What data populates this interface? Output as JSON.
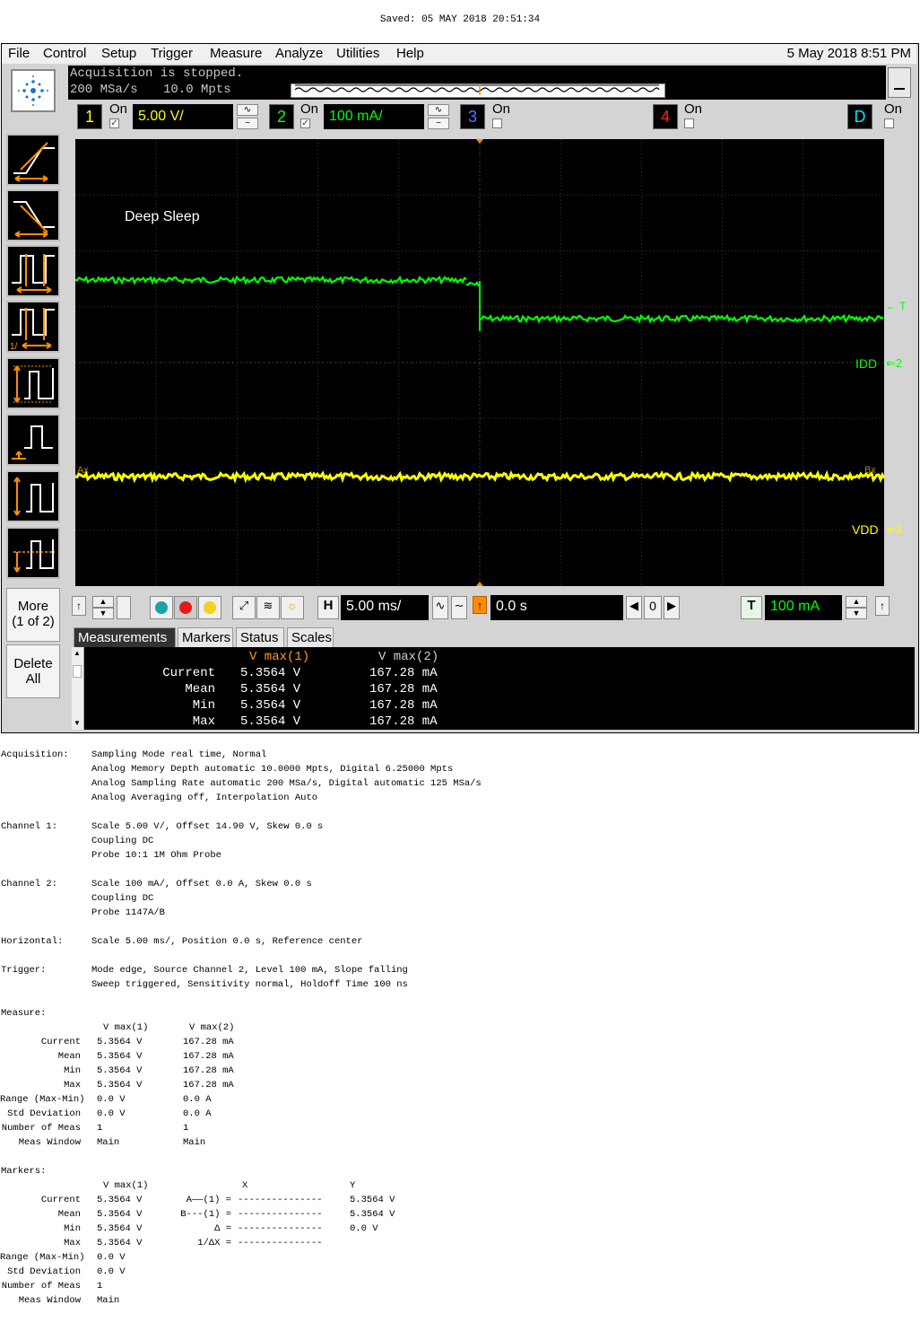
{
  "saved_text": "Saved: 05 MAY 2018  20:51:34",
  "menu": {
    "items": [
      "File",
      "Control",
      "Setup",
      "Trigger",
      "Measure",
      "Analyze",
      "Utilities",
      "Help"
    ],
    "datetime": "5 May 2018  8:51 PM"
  },
  "acquisition": {
    "status": "Acquisition is stopped.",
    "rate": "200 MSa/s",
    "points": "10.0 Mpts"
  },
  "channels": [
    {
      "num": "1",
      "on_label": "On",
      "checked": true,
      "scale": "5.00 V/",
      "color": "#ffff00"
    },
    {
      "num": "2",
      "on_label": "On",
      "checked": true,
      "scale": "100 mA/",
      "color": "#00ff00"
    },
    {
      "num": "3",
      "on_label": "On",
      "checked": false,
      "color": "#4a7dff"
    },
    {
      "num": "4",
      "on_label": "On",
      "checked": false,
      "color": "#ff2020"
    },
    {
      "num": "D",
      "on_label": "On",
      "checked": false,
      "color": "#00e5ff"
    }
  ],
  "waveform": {
    "annotation": "Deep Sleep",
    "idd_label": "IDD",
    "idd_marker": "2",
    "vdd_label": "VDD",
    "vdd_marker": "1",
    "trigger_marker": "T",
    "channel1_color": "#ffff00",
    "channel2_color": "#00ff00"
  },
  "left_toolbar": {
    "more_line1": "More",
    "more_line2": "(1 of 2)",
    "delete_line1": "Delete",
    "delete_line2": "All"
  },
  "controls": {
    "horizontal_label": "H",
    "timebase": "5.00 ms/",
    "position": "0.0 s",
    "zero_label": "0",
    "trigger_label": "T",
    "trigger_level": "100 mA"
  },
  "tabs": [
    "Measurements",
    "Markers",
    "Status",
    "Scales"
  ],
  "measurements": {
    "header1": "V max(1)",
    "header2": "V max(2)",
    "rows": [
      {
        "label": "Current",
        "v1": "5.3564 V",
        "v2": "167.28 mA"
      },
      {
        "label": "Mean",
        "v1": "5.3564 V",
        "v2": "167.28 mA"
      },
      {
        "label": "Min",
        "v1": "5.3564 V",
        "v2": "167.28 mA"
      },
      {
        "label": "Max",
        "v1": "5.3564 V",
        "v2": "167.28 mA"
      }
    ]
  },
  "report": {
    "acquisition_label": "Acquisition:",
    "acquisition_lines": [
      "Sampling Mode real time, Normal",
      "Analog Memory Depth automatic 10.0000 Mpts, Digital 6.25000 Mpts",
      "Analog Sampling Rate automatic 200 MSa/s, Digital automatic 125 MSa/s",
      "Analog Averaging off, Interpolation Auto"
    ],
    "channel1_label": "Channel 1:",
    "channel1_lines": [
      "Scale 5.00 V/, Offset 14.90 V, Skew 0.0 s",
      "Coupling DC",
      "Probe 10:1 1M Ohm Probe"
    ],
    "channel2_label": "Channel 2:",
    "channel2_lines": [
      "Scale 100 mA/, Offset 0.0 A, Skew 0.0 s",
      "Coupling DC",
      "Probe 1147A/B"
    ],
    "horizontal_label": "Horizontal:",
    "horizontal_lines": [
      "Scale 5.00 ms/, Position 0.0 s, Reference center"
    ],
    "trigger_label": "Trigger:",
    "trigger_lines": [
      "Mode edge, Source Channel 2, Level 100 mA, Slope falling",
      "Sweep triggered, Sensitivity normal, Holdoff Time 100 ns"
    ],
    "measure_label": "Measure:",
    "measure_header": [
      "V max(1)",
      "V max(2)"
    ],
    "measure_rows": [
      {
        "label": "Current",
        "a": "5.3564 V",
        "b": "167.28 mA"
      },
      {
        "label": "Mean",
        "a": "5.3564 V",
        "b": "167.28 mA"
      },
      {
        "label": "Min",
        "a": "5.3564 V",
        "b": "167.28 mA"
      },
      {
        "label": "Max",
        "a": "5.3564 V",
        "b": "167.28 mA"
      },
      {
        "label": "Range (Max-Min)",
        "a": "0.0 V",
        "b": "0.0 A"
      },
      {
        "label": "Std Deviation",
        "a": "0.0 V",
        "b": "0.0 A"
      },
      {
        "label": "Number of Meas",
        "a": "1",
        "b": "1"
      },
      {
        "label": "Meas Window",
        "a": "Main",
        "b": "Main"
      }
    ],
    "markers_label": "Markers:",
    "markers_header": [
      "V max(1)",
      "X",
      "Y"
    ],
    "markers_rows": [
      {
        "label": "Current",
        "a": "5.3564 V",
        "m": "A——(1) =",
        "x": "---------------",
        "y": "5.3564 V"
      },
      {
        "label": "Mean",
        "a": "5.3564 V",
        "m": "B---(1) =",
        "x": "---------------",
        "y": "5.3564 V"
      },
      {
        "label": "Min",
        "a": "5.3564 V",
        "m": "Δ =",
        "x": "---------------",
        "y": "0.0 V"
      },
      {
        "label": "Max",
        "a": "5.3564 V",
        "m": "1/ΔX =",
        "x": "---------------",
        "y": ""
      },
      {
        "label": "Range (Max-Min)",
        "a": "0.0 V",
        "m": "",
        "x": "",
        "y": ""
      },
      {
        "label": "Std Deviation",
        "a": "0.0 V",
        "m": "",
        "x": "",
        "y": ""
      },
      {
        "label": "Number of Meas",
        "a": "1",
        "m": "",
        "x": "",
        "y": ""
      },
      {
        "label": "Meas Window",
        "a": "Main",
        "m": "",
        "x": "",
        "y": ""
      }
    ]
  }
}
